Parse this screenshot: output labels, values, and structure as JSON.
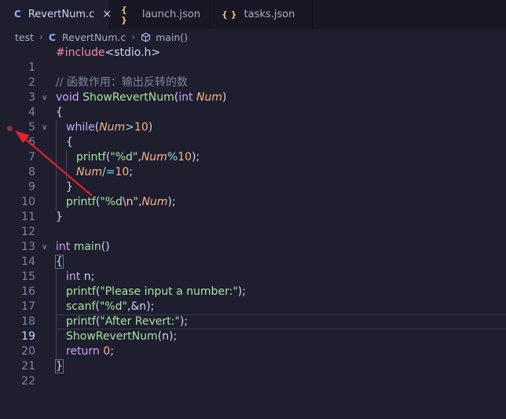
{
  "tabs": [
    {
      "icon": "C",
      "label": "RevertNum.c",
      "close": "×",
      "active": true
    },
    {
      "icon": "{ }",
      "label": "launch.json"
    },
    {
      "icon": "{ }",
      "label": "tasks.json"
    }
  ],
  "breadcrumb": {
    "folder": "test",
    "file_icon": "C",
    "file": "RevertNum.c",
    "symbol": "main()",
    "separator": "›"
  },
  "line_numbers": [
    "1",
    "2",
    "3",
    "4",
    "5",
    "6",
    "7",
    "8",
    "9",
    "10",
    "11",
    "12",
    "13",
    "14",
    "15",
    "16",
    "17",
    "18",
    "19",
    "20",
    "21",
    "22"
  ],
  "fold_marker": "∨",
  "code": {
    "l1": {
      "a": "#include",
      "b": "<stdio.h>"
    },
    "l3": {
      "a": "// 函数作用：输出反转的数"
    },
    "l4": {
      "a": "void",
      "b": "ShowRevertNum",
      "c": "(",
      "d": "int",
      "e": "Num",
      "f": ")"
    },
    "l5": {
      "a": "{"
    },
    "l6": {
      "a": "while",
      "b": "(",
      "c": "Num",
      "d": ">",
      "e": "10",
      "f": ")"
    },
    "l7": {
      "a": "{"
    },
    "l8": {
      "a": "printf",
      "b": "(",
      "c": "\"%d\"",
      "d": ",",
      "e": "Num",
      "f": "%",
      "g": "10",
      "h": ");"
    },
    "l9": {
      "a": "Num",
      "b": "/=",
      "c": "10",
      "d": ";"
    },
    "l10": {
      "a": "}"
    },
    "l11": {
      "a": "printf",
      "b": "(",
      "c": "\"%d",
      "d": "\\n",
      "e": "\"",
      "f": ",",
      "g": "Num",
      "h": ");"
    },
    "l12": {
      "a": "}"
    },
    "l14": {
      "a": "int",
      "b": "main",
      "c": "()"
    },
    "l15": {
      "a": "{"
    },
    "l16": {
      "a": "int",
      "b": " n;"
    },
    "l17": {
      "a": "printf",
      "b": "(",
      "c": "\"Please input a number:\"",
      "d": ");"
    },
    "l18": {
      "a": "scanf",
      "b": "(",
      "c": "\"%d\"",
      "d": ",&n);"
    },
    "l19": {
      "a": "printf",
      "b": "(",
      "c": "\"After Revert:\"",
      "d": ");"
    },
    "l20": {
      "a": "ShowRevertNum",
      "b": "(n);"
    },
    "l21": {
      "a": "return",
      "b": " ",
      "c": "0",
      "d": ";"
    },
    "l22": {
      "a": "}"
    }
  },
  "colors": {
    "background": "#1e1e2e",
    "breakpoint": "#8e2f3a",
    "annotation_arrow": "#e0202a"
  }
}
